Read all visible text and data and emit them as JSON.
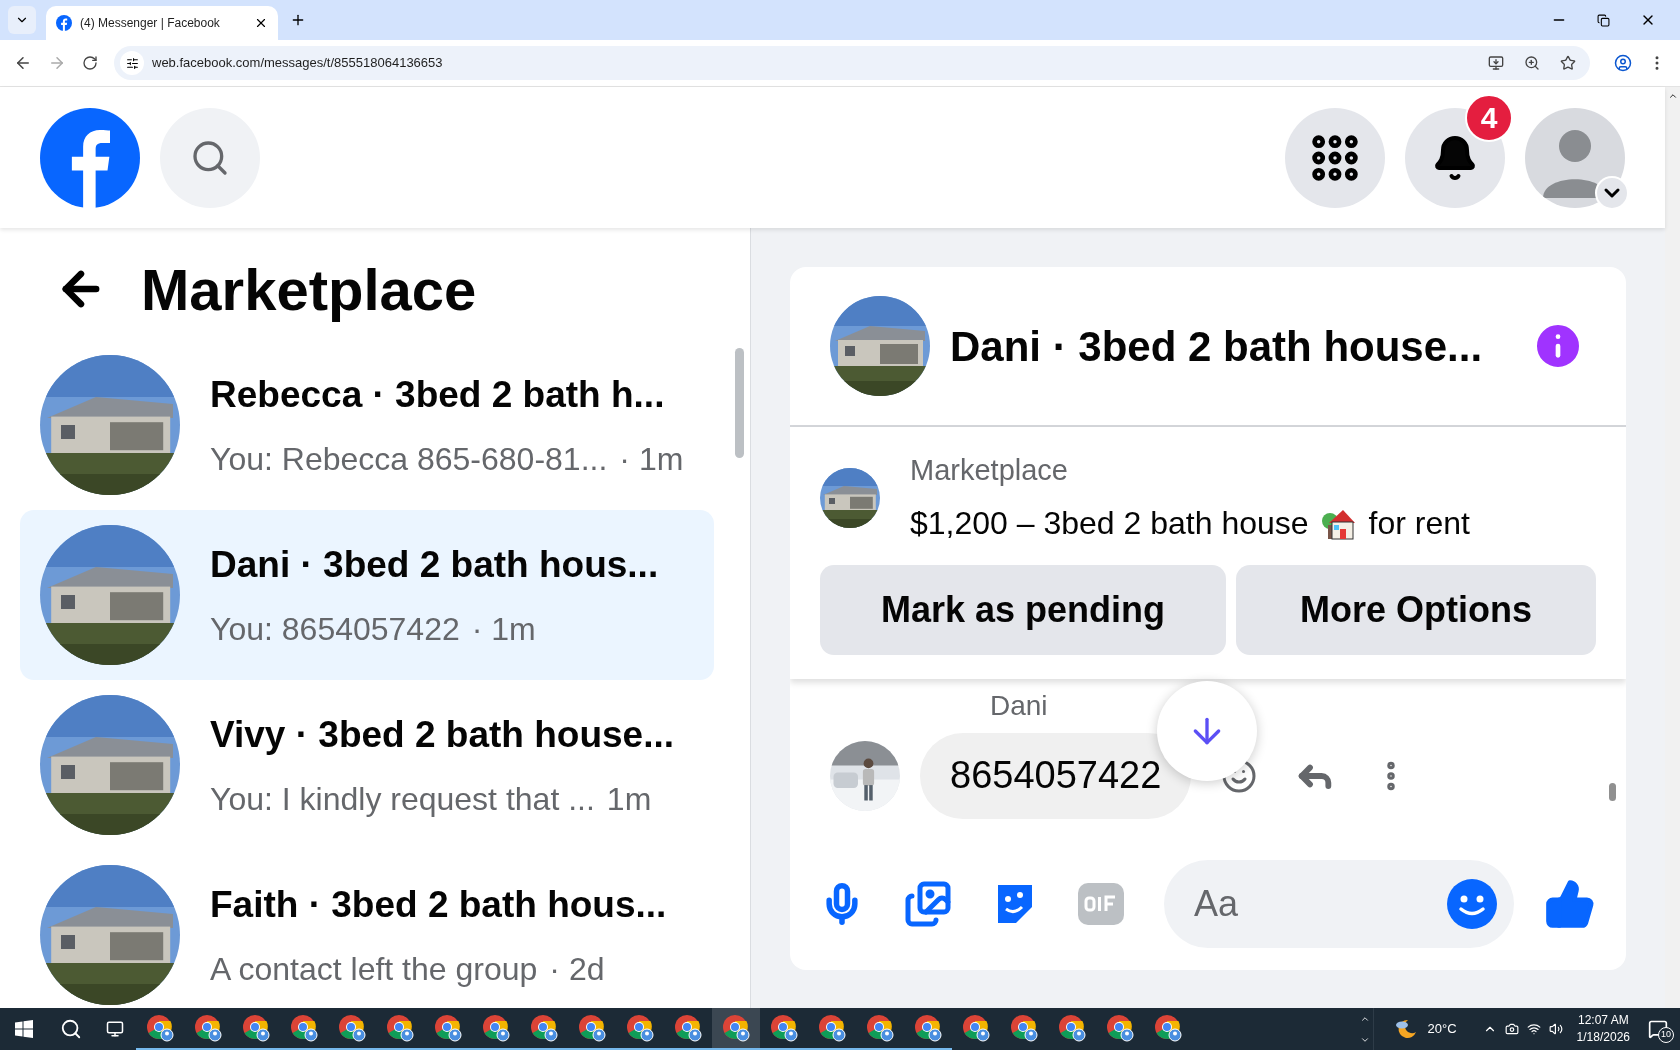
{
  "browser": {
    "tab_title": "(4) Messenger | Facebook",
    "url": "web.facebook.com/messages/t/855518064136653"
  },
  "header": {
    "notification_count": "4"
  },
  "sidebar": {
    "title": "Marketplace",
    "conversations": [
      {
        "name": "Rebecca · 3bed 2 bath h...",
        "preview": "You: Rebecca 865-680-81...",
        "time": "· 1m",
        "selected": false
      },
      {
        "name": "Dani · 3bed 2 bath hous...",
        "preview": "You: 8654057422",
        "time": "· 1m",
        "selected": true
      },
      {
        "name": "Vivy · 3bed 2 bath house...",
        "preview": "You: I kindly request that ...",
        "time": "1m",
        "selected": false
      },
      {
        "name": "Faith · 3bed 2 bath hous...",
        "preview": "A contact left the group",
        "time": "· 2d",
        "selected": false
      }
    ]
  },
  "chat": {
    "title": "Dani · 3bed 2 bath house...",
    "listing": {
      "source": "Marketplace",
      "title": "$1,200 – 3bed 2 bath house",
      "suffix": "for rent"
    },
    "actions": [
      "Mark as pending",
      "More Options"
    ],
    "messages": [
      {
        "sender": "Dani",
        "text": "8654057422"
      }
    ],
    "composer": {
      "placeholder": "Aa"
    }
  },
  "taskbar": {
    "apps": [
      {
        "selected": false,
        "running": true
      },
      {
        "selected": false,
        "running": true
      },
      {
        "selected": false,
        "running": true
      },
      {
        "selected": false,
        "running": true
      },
      {
        "selected": false,
        "running": true
      },
      {
        "selected": false,
        "running": true
      },
      {
        "selected": false,
        "running": true
      },
      {
        "selected": false,
        "running": true
      },
      {
        "selected": false,
        "running": true
      },
      {
        "selected": false,
        "running": true
      },
      {
        "selected": false,
        "running": true
      },
      {
        "selected": false,
        "running": true
      },
      {
        "selected": true,
        "running": true
      },
      {
        "selected": false,
        "running": true
      },
      {
        "selected": false,
        "running": true
      },
      {
        "selected": false,
        "running": true
      },
      {
        "selected": false,
        "running": true
      },
      {
        "selected": false,
        "running": false
      },
      {
        "selected": false,
        "running": false
      },
      {
        "selected": false,
        "running": false
      },
      {
        "selected": false,
        "running": false
      },
      {
        "selected": false,
        "running": false
      }
    ],
    "temperature": "20°C",
    "time": "12:07 AM",
    "date": "1/18/2026",
    "notification_count": "10"
  }
}
